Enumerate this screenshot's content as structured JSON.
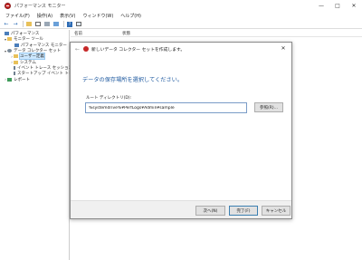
{
  "window": {
    "title": "パフォーマンス モニター"
  },
  "menu": [
    "ファイル(F)",
    "操作(A)",
    "表示(V)",
    "ウィンドウ(W)",
    "ヘルプ(H)"
  ],
  "tree": {
    "items": [
      {
        "label": "パフォーマンス",
        "arrow": "",
        "icon": "chart"
      },
      {
        "label": "モニター ツール",
        "arrow": "▾",
        "icon": "folder"
      },
      {
        "label": "パフォーマンス モニター",
        "arrow": "",
        "icon": "chart"
      },
      {
        "label": "データ コレクター セット",
        "arrow": "▾",
        "icon": "gear"
      },
      {
        "label": "ユーザー定義",
        "arrow": "›",
        "icon": "folder",
        "selected": true
      },
      {
        "label": "システム",
        "arrow": "›",
        "icon": "folder"
      },
      {
        "label": "イベント トレース セッション",
        "arrow": "",
        "icon": "doc"
      },
      {
        "label": "スタートアップ イベント トレース",
        "arrow": "",
        "icon": "doc"
      },
      {
        "label": "レポート",
        "arrow": "›",
        "icon": "report"
      }
    ]
  },
  "list": {
    "col_name": "名前",
    "col_status": "状態"
  },
  "dialog": {
    "title": "新しいデータ コレクター セットを作成します。",
    "heading": "データの保存場所を選択してください。",
    "root_label": "ルート ディレクトリ(D):",
    "root_value": "%systemdrive%¥PerfLogs¥Admin¥sample",
    "browse_label": "参照(R)...",
    "next_label": "次へ(N)",
    "finish_label": "完了(F)",
    "cancel_label": "キャンセル"
  },
  "colors": {
    "heading": "#1f5aa0",
    "selection": "#cde8ff",
    "app_icon": "#c62828"
  }
}
